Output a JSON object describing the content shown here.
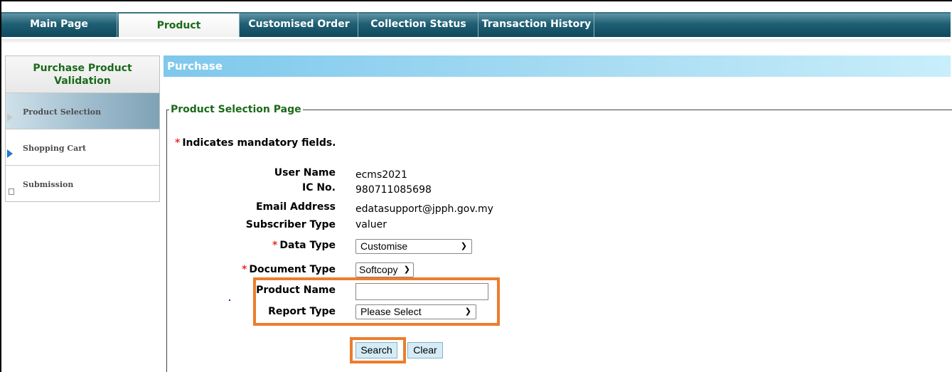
{
  "nav": {
    "tabs": [
      {
        "label": "Main Page"
      },
      {
        "label": "Product"
      },
      {
        "label": "Customised Order"
      },
      {
        "label": "Collection Status"
      },
      {
        "label": "Transaction History"
      }
    ],
    "active_tab": "Product"
  },
  "sidebar": {
    "title": "Purchase Product Validation",
    "items": [
      {
        "label": "Product Selection",
        "state": "active",
        "icon": "triangle-outline-icon"
      },
      {
        "label": "Shopping Cart",
        "state": "current",
        "icon": "triangle-solid-icon"
      },
      {
        "label": "Submission",
        "state": "pending",
        "icon": "square-outline-icon"
      }
    ]
  },
  "main": {
    "banner": "Purchase",
    "section_title": "Product Selection Page",
    "mandatory_star": "*",
    "mandatory_note": "Indicates mandatory fields.",
    "fields": {
      "user_name_label": "User Name",
      "user_name_value": "ecms2021",
      "ic_label": "IC No.",
      "ic_value": "980711085698",
      "email_label": "Email Address",
      "email_value": "edatasupport@jpph.gov.my",
      "subscriber_label": "Subscriber Type",
      "subscriber_value": "valuer",
      "data_type_label": "Data Type",
      "data_type_value": "Customise",
      "document_type_label": "Document Type",
      "document_type_value": "Softcopy",
      "product_name_label": "Product Name",
      "product_name_value": "",
      "report_type_label": "Report Type",
      "report_type_value": "Please Select"
    },
    "buttons": {
      "search": "Search",
      "clear": "Clear"
    }
  },
  "colors": {
    "nav_dark": "#0f4a5e",
    "active_green": "#1a6a1a",
    "banner_blue": "#7ec8ec",
    "highlight_orange": "#ec7d2c",
    "required_red": "#e8322a"
  }
}
